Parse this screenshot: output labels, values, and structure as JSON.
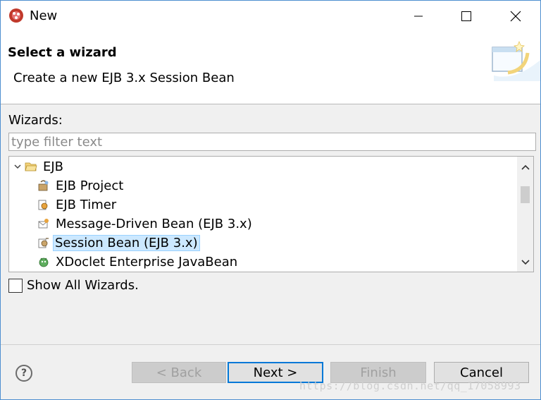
{
  "window": {
    "title": "New",
    "controls": {
      "minimize": "minimize-icon",
      "maximize": "maximize-icon",
      "close": "close-icon"
    }
  },
  "header": {
    "title": "Select a wizard",
    "description": "Create a new EJB 3.x Session Bean"
  },
  "wizards": {
    "label": "Wizards:",
    "filter_placeholder": "type filter text",
    "filter_value": "",
    "tree": [
      {
        "label": "EJB",
        "type": "folder",
        "expanded": true,
        "icon": "folder-open-icon"
      },
      {
        "label": "EJB Project",
        "type": "item",
        "icon": "ejb-project-icon"
      },
      {
        "label": "EJB Timer",
        "type": "item",
        "icon": "ejb-timer-icon"
      },
      {
        "label": "Message-Driven Bean (EJB 3.x)",
        "type": "item",
        "icon": "message-bean-icon"
      },
      {
        "label": "Session Bean (EJB 3.x)",
        "type": "item",
        "icon": "session-bean-icon",
        "selected": true
      },
      {
        "label": "XDoclet Enterprise JavaBean",
        "type": "item",
        "icon": "xdoclet-icon"
      }
    ]
  },
  "show_all": {
    "label": "Show All Wizards.",
    "checked": false
  },
  "buttons": {
    "help": "?",
    "back": "< Back",
    "next": "Next >",
    "finish": "Finish",
    "cancel": "Cancel"
  },
  "watermark": "https://blog.csdn.net/qq_17058993",
  "colors": {
    "selection": "#cce8ff",
    "default_button_border": "#0078d7",
    "header_bg": "#ffffff",
    "body_bg": "#f0f0f0"
  }
}
